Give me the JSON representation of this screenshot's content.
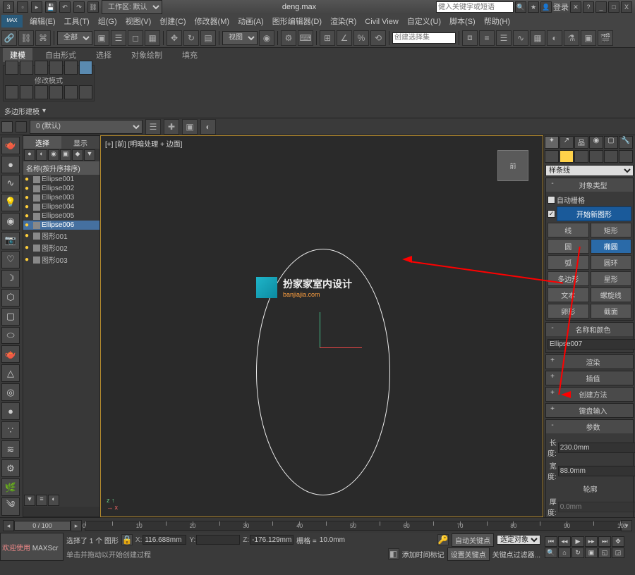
{
  "titlebar": {
    "filename": "deng.max",
    "workspace_label": "工作区: 默认",
    "search_placeholder": "健入关键字或短语",
    "login": "登录",
    "min": "_",
    "max": "□",
    "close": "X"
  },
  "menus": {
    "logo": "MAX",
    "items": [
      "编辑(E)",
      "工具(T)",
      "组(G)",
      "视图(V)",
      "创建(C)",
      "修改器(M)",
      "动画(A)",
      "图形编辑器(D)",
      "渲染(R)",
      "Civil View",
      "自定义(U)",
      "脚本(S)",
      "帮助(H)"
    ]
  },
  "maintoolbar": {
    "select_mode": "全部",
    "view_mode": "视图",
    "selection_set_hint": "创建选择集"
  },
  "ribbon": {
    "tabs": [
      "建模",
      "自由形式",
      "选择",
      "对象绘制",
      "填充"
    ],
    "group1": "修改模式",
    "group2": "多边形建模"
  },
  "layerbar": {
    "current": "0 (默认)"
  },
  "outliner": {
    "tabs": [
      "选择",
      "显示"
    ],
    "header": "名称(按升序排序)",
    "items": [
      {
        "name": "Ellipse001",
        "sel": false
      },
      {
        "name": "Ellipse002",
        "sel": false
      },
      {
        "name": "Ellipse003",
        "sel": false
      },
      {
        "name": "Ellipse004",
        "sel": false
      },
      {
        "name": "Ellipse005",
        "sel": false
      },
      {
        "name": "Ellipse006",
        "sel": true
      },
      {
        "name": "图形001",
        "sel": false
      },
      {
        "name": "图形002",
        "sel": false
      },
      {
        "name": "图形003",
        "sel": false
      }
    ]
  },
  "viewport": {
    "label": "[+] [前] [明暗处理 + 边面]",
    "cube": "前"
  },
  "watermark": {
    "title": "扮家家室内设计",
    "url": "banjiajia.com"
  },
  "command_panel": {
    "category": "样条线",
    "rollout_objtype": "对象类型",
    "auto_grid": "自动栅格",
    "start_new_shape": "开始新图形",
    "shapes": [
      {
        "l": "线",
        "r": "矩形",
        "la": false,
        "ra": false
      },
      {
        "l": "圆",
        "r": "椭圆",
        "la": false,
        "ra": true
      },
      {
        "l": "弧",
        "r": "圆环",
        "la": false,
        "ra": false
      },
      {
        "l": "多边形",
        "r": "星形",
        "la": false,
        "ra": false
      },
      {
        "l": "文本",
        "r": "螺旋线",
        "la": false,
        "ra": false
      },
      {
        "l": "卵形",
        "r": "截面",
        "la": false,
        "ra": false
      }
    ],
    "rollout_name": "名称和颜色",
    "obj_name": "Ellipse007",
    "rollouts_collapsed": [
      "渲染",
      "插值",
      "创建方法",
      "键盘输入"
    ],
    "rollout_params": "参数",
    "len_label": "长度:",
    "len_value": "230.0mm",
    "wid_label": "宽度:",
    "wid_value": "88.0mm",
    "outline_label": "轮廓",
    "thick_label": "厚度:",
    "thick_value": "0.0mm"
  },
  "timeslider": {
    "position": "0 / 100",
    "end": "100"
  },
  "status": {
    "welcome1": "欢迎使用",
    "welcome2": "MAXScr",
    "sel_info": "选择了 1 个 图形",
    "hint": "单击并拖动以开始创建过程",
    "x": "116.688mm",
    "y": " ",
    "z": "-176.129mm",
    "grid_label": "栅格 =",
    "grid": "10.0mm",
    "add_time": "添加时间标记",
    "autokey": "自动关键点",
    "sel_mode": "选定对象",
    "setkey": "设置关键点",
    "keyfilter": "关键点过滤器..."
  }
}
